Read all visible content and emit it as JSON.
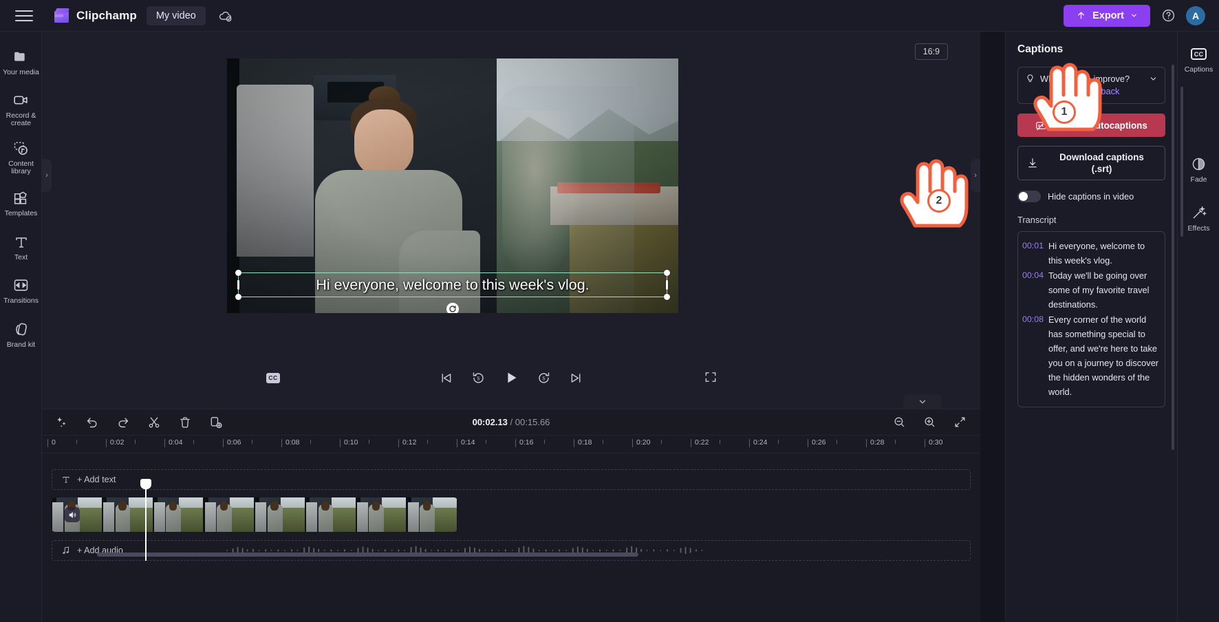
{
  "topbar": {
    "menu_icon": "hamburger-menu-icon",
    "brand": "Clipchamp",
    "project_name": "My video",
    "cloud_icon": "cloud-saved-icon",
    "export_label": "Export",
    "help_icon": "help-circle-icon",
    "avatar_initial": "A"
  },
  "left_rail": [
    {
      "label": "Your media",
      "icon": "folder-icon"
    },
    {
      "label": "Record & create",
      "icon": "video-camera-icon"
    },
    {
      "label": "Content library",
      "icon": "content-library-icon"
    },
    {
      "label": "Templates",
      "icon": "templates-grid-icon"
    },
    {
      "label": "Text",
      "icon": "text-t-icon"
    },
    {
      "label": "Transitions",
      "icon": "transitions-icon"
    },
    {
      "label": "Brand kit",
      "icon": "brand-kit-icon"
    }
  ],
  "stage": {
    "aspect_ratio": "16:9",
    "caption_overlay_text": "Hi everyone, welcome to this week's vlog.",
    "rotate_handle": "rotate-icon",
    "collapse_left": "›",
    "collapse_right": "›"
  },
  "player": {
    "cc_badge": "CC",
    "skip_start_icon": "skip-to-start-icon",
    "rewind_label": "5",
    "play_icon": "play-icon",
    "forward_label": "5",
    "skip_end_icon": "skip-to-end-icon",
    "fullscreen_icon": "fullscreen-icon"
  },
  "captions_panel": {
    "title": "Captions",
    "feedback_prompt": "What can we improve?",
    "feedback_icon": "lightbulb-icon",
    "feedback_chevron": "chevron-down-icon",
    "feedback_link": "Give feedback",
    "turn_off_label": "Turn off autocaptions",
    "turn_off_icon": "captions-off-icon",
    "download_label_line1": "Download captions",
    "download_label_line2": "(.srt)",
    "download_icon": "download-icon",
    "toggle_label": "Hide captions in video",
    "toggle_state": "off",
    "transcript_heading": "Transcript",
    "transcript": [
      {
        "time": "00:01",
        "text": "Hi everyone, welcome to this week's vlog."
      },
      {
        "time": "00:04",
        "text": "Today we'll be going over some of my favorite travel destinations."
      },
      {
        "time": "00:08",
        "text": "Every corner of the world has something special to offer, and we're here to take you on a journey to discover the hidden wonders of the world."
      }
    ]
  },
  "right_rail": [
    {
      "label": "Captions",
      "icon": "cc-icon",
      "active": true
    },
    {
      "label": "Fade",
      "icon": "fade-icon",
      "active": false
    },
    {
      "label": "Effects",
      "icon": "effects-wand-icon",
      "active": false
    }
  ],
  "timeline": {
    "tools": [
      {
        "name": "magic-tools-icon",
        "label": ""
      },
      {
        "name": "undo-icon",
        "label": ""
      },
      {
        "name": "redo-icon",
        "label": ""
      },
      {
        "name": "split-scissors-icon",
        "label": ""
      },
      {
        "name": "delete-trash-icon",
        "label": ""
      },
      {
        "name": "duplicate-icon",
        "label": ""
      }
    ],
    "current_time": "00:02.13",
    "separator": "/",
    "total_time": "00:15.66",
    "zoom_out_icon": "zoom-out-icon",
    "zoom_in_icon": "zoom-in-icon",
    "fit_icon": "fit-to-screen-icon",
    "collapse_chevron": "chevron-down-icon",
    "ruler_ticks": [
      "0",
      "0:02",
      "0:04",
      "0:06",
      "0:08",
      "0:10",
      "0:12",
      "0:14",
      "0:16",
      "0:18",
      "0:20",
      "0:22",
      "0:24",
      "0:26",
      "0:28",
      "0:30"
    ],
    "add_text_label": "+ Add text",
    "add_text_icon": "text-t-icon",
    "add_audio_label": "+ Add audio",
    "add_audio_icon": "music-note-icon",
    "clip_audio_icon": "speaker-icon"
  },
  "annotations": [
    {
      "number": "1",
      "target": "captions-rail-button"
    },
    {
      "number": "2",
      "target": "download-captions-button"
    }
  ],
  "colors": {
    "accent_purple": "#8b3ff0",
    "danger_red": "#b8394f",
    "link_purple": "#a98cf7",
    "timestamp_purple": "#9b7cf0",
    "selection_green": "#8fe3bd",
    "annotation_orange": "#f2603f"
  }
}
